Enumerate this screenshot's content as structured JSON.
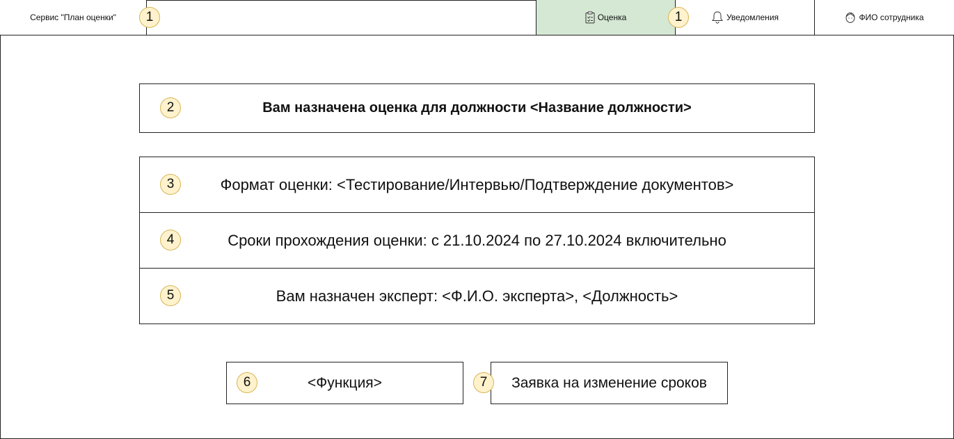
{
  "header": {
    "service_title": "Сервис \"План оценки\"",
    "nav": {
      "assessment_label": "Оценка",
      "notifications_label": "Уведомления",
      "employee_label": "ФИО сотрудника"
    }
  },
  "markers": [
    "1",
    "1",
    "2",
    "3",
    "4",
    "5",
    "6",
    "7"
  ],
  "main": {
    "assignment_heading": "Вам назначена оценка для должности <Название должности>",
    "format_text": "Формат оценки: <Тестирование/Интервью/Подтверждение документов>",
    "deadline_text": "Сроки прохождения оценки: с 21.10.2024 по 27.10.2024 включительно",
    "expert_text": "Вам назначен эксперт: <Ф.И.О. эксперта>, <Должность>"
  },
  "actions": {
    "function_label": "<Функция>",
    "change_request_label": "Заявка на изменение сроков"
  },
  "colors": {
    "active_tab": "#d5e8d4",
    "marker_fill": "#fff2cc",
    "marker_border": "#d6b656"
  }
}
